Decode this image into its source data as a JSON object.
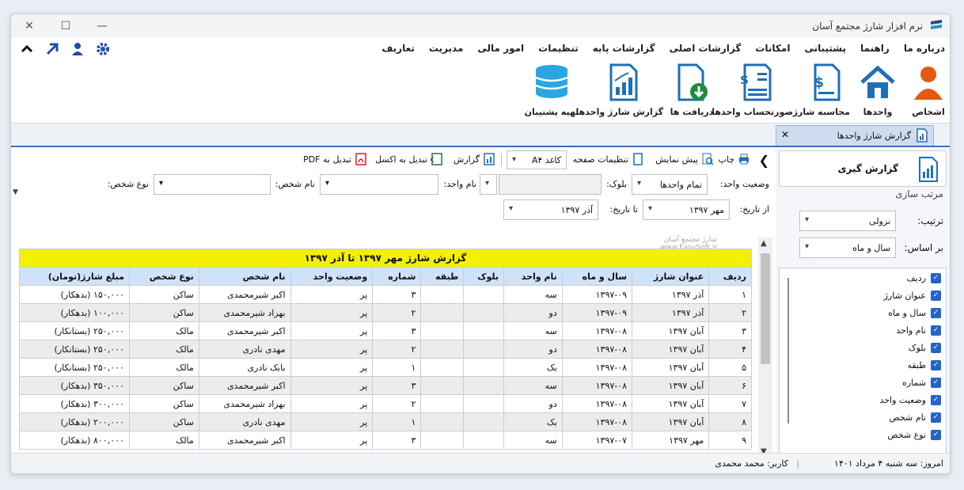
{
  "window": {
    "title": "نرم افزار شارژ مجتمع آسان"
  },
  "menu": [
    "تعاریف",
    "مدیریت",
    "امور مالی",
    "تنظیمات",
    "گزارشات پایه",
    "گزارشات اصلی",
    "امکانات",
    "پشتیبانی",
    "راهنما",
    "درباره ما"
  ],
  "ribbon": {
    "persons": "اشخاص",
    "units": "واحدها",
    "charge_calc": "محاسبه شارژ",
    "invoice": "صورتحساب واحدها",
    "receipts": "دریافت ها",
    "unit_report": "گزارش شارژ واحدها",
    "backup": "تهیه پشتیبان"
  },
  "doc_tab": {
    "label": "گزارش شارژ واحدها"
  },
  "toolbar": {
    "print": "چاپ",
    "preview": "پیش نمایش",
    "page_settings": "تنظیمات صفحه",
    "paper": "کاغذ A۴",
    "report": "گزارش",
    "to_excel": "تبدیل به اکسل",
    "to_pdf": "تبدیل به PDF"
  },
  "filters": {
    "unit_status_label": "وضعیت واحد:",
    "unit_status_value": "تمام واحدها",
    "block_label": "بلوک:",
    "unit_name_label": "نام واحد:",
    "person_name_label": "نام شخص:",
    "person_type_label": "نوع شخص:",
    "from_date_label": "از تاریخ:",
    "from_date_value": "مهر ۱۳۹۷",
    "to_date_label": "تا تاریخ:",
    "to_date_value": "آذر ۱۳۹۷"
  },
  "watermark": {
    "line1": "شارژ مجتمع آسان",
    "line2": "www.EasySoft.ir"
  },
  "side": {
    "report_button": "گزارش گیری",
    "sort_title": "مرتب سازی",
    "order_label": "ترتیب:",
    "order_value": "نزولی",
    "by_label": "بر اساس:",
    "by_value": "سال و ماه",
    "fields": [
      "ردیف",
      "عنوان شارژ",
      "سال و ماه",
      "نام واحد",
      "بلوک",
      "طبقه",
      "شماره",
      "وضعیت واحد",
      "نام شخص",
      "نوع شخص"
    ]
  },
  "grid": {
    "title": "گزارش شارژ مهر ۱۳۹۷ تا آذر ۱۳۹۷",
    "columns": [
      "ردیف",
      "عنوان شارژ",
      "سال و ماه",
      "نام واحد",
      "بلوک",
      "طبقه",
      "شماره",
      "وضعیت واحد",
      "نام شخص",
      "نوع شخص",
      "مبلغ شارژ(تومان)"
    ],
    "rows": [
      [
        "۱",
        "آذر ۱۳۹۷",
        "۱۳۹۷-۰۹",
        "سه",
        "",
        "",
        "۳",
        "پر",
        "اکبر شیرمحمدی",
        "ساکن",
        "۱۵۰,۰۰۰ (بدهکار)"
      ],
      [
        "۲",
        "آذر ۱۳۹۷",
        "۱۳۹۷-۰۹",
        "دو",
        "",
        "",
        "۲",
        "پر",
        "بهزاد شیرمحمدی",
        "ساکن",
        "۱۰۰,۰۰۰ (بدهکار)"
      ],
      [
        "۳",
        "آبان ۱۳۹۷",
        "۱۳۹۷-۰۸",
        "سه",
        "",
        "",
        "۳",
        "پر",
        "اکبر شیرمحمدی",
        "مالک",
        "۲۵۰,۰۰۰ (بستانکار)"
      ],
      [
        "۴",
        "آبان ۱۳۹۷",
        "۱۳۹۷-۰۸",
        "دو",
        "",
        "",
        "۲",
        "پر",
        "مهدی نادری",
        "مالک",
        "۲۵۰,۰۰۰ (بستانکار)"
      ],
      [
        "۵",
        "آبان ۱۳۹۷",
        "۱۳۹۷-۰۸",
        "یک",
        "",
        "",
        "۱",
        "پر",
        "بابک نادری",
        "مالک",
        "۲۵۰,۰۰۰ (بستانکار)"
      ],
      [
        "۶",
        "آبان ۱۳۹۷",
        "۱۳۹۷-۰۸",
        "سه",
        "",
        "",
        "۳",
        "پر",
        "اکبر شیرمحمدی",
        "ساکن",
        "۳۵۰,۰۰۰ (بدهکار)"
      ],
      [
        "۷",
        "آبان ۱۳۹۷",
        "۱۳۹۷-۰۸",
        "دو",
        "",
        "",
        "۲",
        "پر",
        "بهزاد شیرمحمدی",
        "ساکن",
        "۳۰۰,۰۰۰ (بدهکار)"
      ],
      [
        "۸",
        "آبان ۱۳۹۷",
        "۱۳۹۷-۰۸",
        "یک",
        "",
        "",
        "۱",
        "پر",
        "مهدی نادری",
        "ساکن",
        "۲۰۰,۰۰۰ (بدهکار)"
      ],
      [
        "۹",
        "مهر ۱۳۹۷",
        "۱۳۹۷-۰۷",
        "سه",
        "",
        "",
        "۳",
        "پر",
        "اکبر شیرمحمدی",
        "مالک",
        "۸۰۰,۰۰۰ (بدهکار)"
      ]
    ]
  },
  "status": {
    "today": "امروز: سه شنبه ۴ مرداد ۱۴۰۱",
    "user": "کاربر: محمد محمدی"
  },
  "colors": {
    "accent": "#2463c7",
    "title_row": "#f3f000",
    "header_row": "#cfe2f7"
  }
}
